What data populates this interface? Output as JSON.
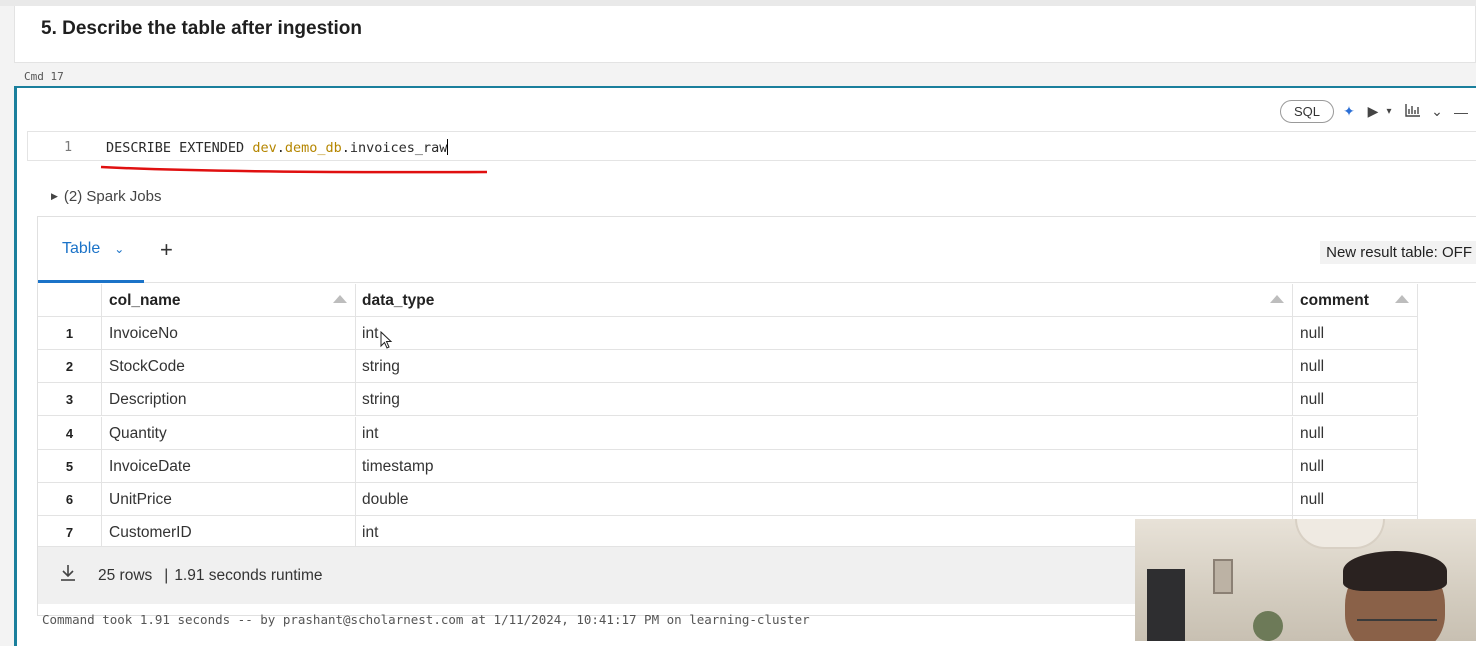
{
  "markdown_cell": {
    "title": "5. Describe the table after ingestion"
  },
  "cmd_label": "Cmd 17",
  "toolbar": {
    "language": "SQL",
    "icons": [
      "sparkle-icon",
      "run-icon",
      "run-menu-icon",
      "chart-icon",
      "chevron-down-icon",
      "minimize-icon"
    ]
  },
  "editor": {
    "line_number": "1",
    "code_keyword": "DESCRIBE EXTENDED ",
    "code_part1": "dev",
    "code_dot1": ".",
    "code_part2": "demo_db",
    "code_rest": ".invoices_raw",
    "token_color": "#b58600"
  },
  "spark_jobs": "(2) Spark Jobs",
  "result": {
    "tab_label": "Table",
    "new_result_toggle": "New result table: OFF",
    "columns": [
      "col_name",
      "data_type",
      "comment"
    ],
    "rows": [
      {
        "n": "1",
        "col_name": "InvoiceNo",
        "data_type": "int",
        "comment": "null"
      },
      {
        "n": "2",
        "col_name": "StockCode",
        "data_type": "string",
        "comment": "null"
      },
      {
        "n": "3",
        "col_name": "Description",
        "data_type": "string",
        "comment": "null"
      },
      {
        "n": "4",
        "col_name": "Quantity",
        "data_type": "int",
        "comment": "null"
      },
      {
        "n": "5",
        "col_name": "InvoiceDate",
        "data_type": "timestamp",
        "comment": "null"
      },
      {
        "n": "6",
        "col_name": "UnitPrice",
        "data_type": "double",
        "comment": "null"
      },
      {
        "n": "7",
        "col_name": "CustomerID",
        "data_type": "int",
        "comment": ""
      }
    ],
    "footer": {
      "rows_count": "25 rows",
      "separator": "|",
      "runtime": "1.91 seconds runtime"
    }
  },
  "command_took": "Command took 1.91 seconds -- by prashant@scholarnest.com at 1/11/2024, 10:41:17 PM on learning-cluster",
  "accent_color": "#1b73c8",
  "cell_border_color": "#1a7f9c"
}
